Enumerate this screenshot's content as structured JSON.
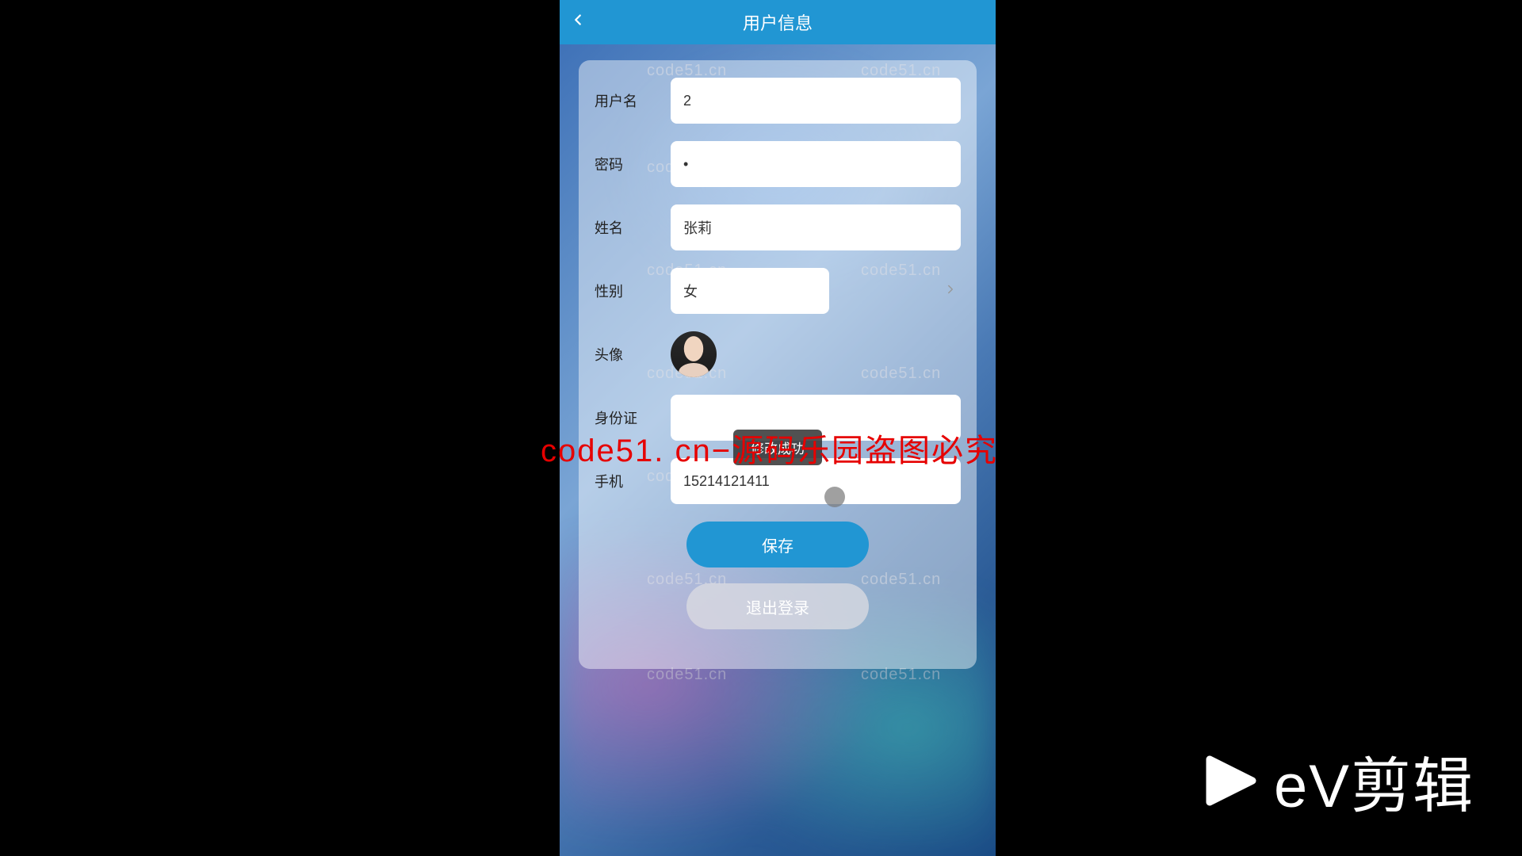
{
  "header": {
    "title": "用户信息"
  },
  "form": {
    "username": {
      "label": "用户名",
      "value": "2"
    },
    "password": {
      "label": "密码",
      "value": "•"
    },
    "name": {
      "label": "姓名",
      "value": "张莉"
    },
    "gender": {
      "label": "性别",
      "value": "女"
    },
    "avatar": {
      "label": "头像"
    },
    "idcard": {
      "label": "身份证",
      "value": ""
    },
    "phone": {
      "label": "手机",
      "value": "15214121411"
    }
  },
  "buttons": {
    "save": "保存",
    "logout": "退出登录"
  },
  "toast": "修改成功",
  "watermark_text": "code51.cn",
  "big_watermark": "code51. cn−源码乐园盗图必究",
  "ev_brand": "eV剪辑"
}
